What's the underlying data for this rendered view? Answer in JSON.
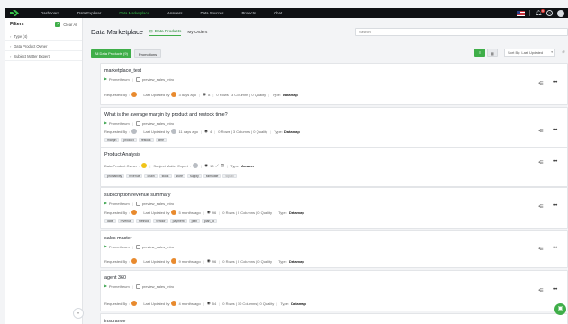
{
  "nav": {
    "items": [
      {
        "label": "Dashboard",
        "active": false
      },
      {
        "label": "Data Explorer",
        "active": false
      },
      {
        "label": "Data Marketplace",
        "active": true
      },
      {
        "label": "Answers",
        "active": false
      },
      {
        "label": "Data Sources",
        "active": false
      },
      {
        "label": "Projects",
        "active": false
      },
      {
        "label": "Chat",
        "active": false
      }
    ],
    "notification_count": "9"
  },
  "sidebar": {
    "title": "Filters",
    "clear_all": "Clear All",
    "items": [
      {
        "label": "Type (4)"
      },
      {
        "label": "Data Product Owner"
      },
      {
        "label": "Subject Matter Expert"
      }
    ]
  },
  "main": {
    "title": "Data Marketplace",
    "tabs": [
      {
        "label": "Data Products",
        "active": true
      },
      {
        "label": "My Orders",
        "active": false
      }
    ],
    "search_placeholder": "Search",
    "filters": [
      {
        "label": "All Data Products (9)",
        "active": true
      },
      {
        "label": "Promotions",
        "active": false
      }
    ],
    "sort": "Sort By: Last Updated"
  },
  "cards": [
    {
      "title": "marketplace_test",
      "source": "Prometheum",
      "dataset": "preview_sales_intro",
      "requested_label": "Requested By",
      "updated": "Last Updated by",
      "ago": "3 days ago",
      "views": "8",
      "stats": "0 Rows | 3 Columns | 0 Quality",
      "type_label": "Type:",
      "type": "Datamap",
      "tags": []
    },
    {
      "title": "What is the average margin by product and restock time?",
      "source": "Prometheum",
      "dataset": "preview_sales_intro",
      "requested_label": "Requested By",
      "updated": "Last Updated by",
      "ago": "11 days ago",
      "views": "4",
      "stats": "0 Rows | 3 Columns | 0 Quality",
      "type_label": "Type:",
      "type": "Datamap",
      "tags": [
        "margin",
        "product",
        "restock",
        "time"
      ]
    },
    {
      "title": "Product Analysis",
      "owner_label": "Data Product Owner",
      "sme_label": "Subject Matter Expert",
      "views": "13",
      "type_label": "Type:",
      "type": "Answer",
      "tags": [
        "profitability",
        "revenue",
        "chain",
        "stock",
        "store",
        "supply",
        "stimulate",
        "top all"
      ]
    },
    {
      "title": "subscription revenue summary",
      "source": "Prometheum",
      "dataset": "preview_sales_intro",
      "requested_label": "Requested By",
      "updated": "Last Updated by",
      "ago": "5 months ago",
      "views": "96",
      "stats": "0 Rows | 0 Columns | 0 Quality",
      "type_label": "Type:",
      "type": "Datamap",
      "tags": [
        "date",
        "revenue",
        "method",
        "vendor",
        "payment",
        "plan",
        "plan_id"
      ]
    },
    {
      "title": "sales master",
      "source": "Prometheum",
      "dataset": "preview_sales_intro",
      "requested_label": "Requested By",
      "updated": "Last Updated by",
      "ago": "9 months ago",
      "views": "96",
      "stats": "0 Rows | 0 Columns | 0 Quality",
      "type_label": "Type:",
      "type": "Datamap",
      "tags": []
    },
    {
      "title": "agent 360",
      "source": "Prometheum",
      "dataset": "preview_sales_intro",
      "requested_label": "Requested By",
      "updated": "Last Updated by",
      "ago": "4 months ago",
      "views": "54",
      "stats": "0 Rows | 10 Columns | 0 Quality",
      "type_label": "Type:",
      "type": "Datamap",
      "tags": []
    },
    {
      "title": "insurance",
      "tags": []
    }
  ]
}
